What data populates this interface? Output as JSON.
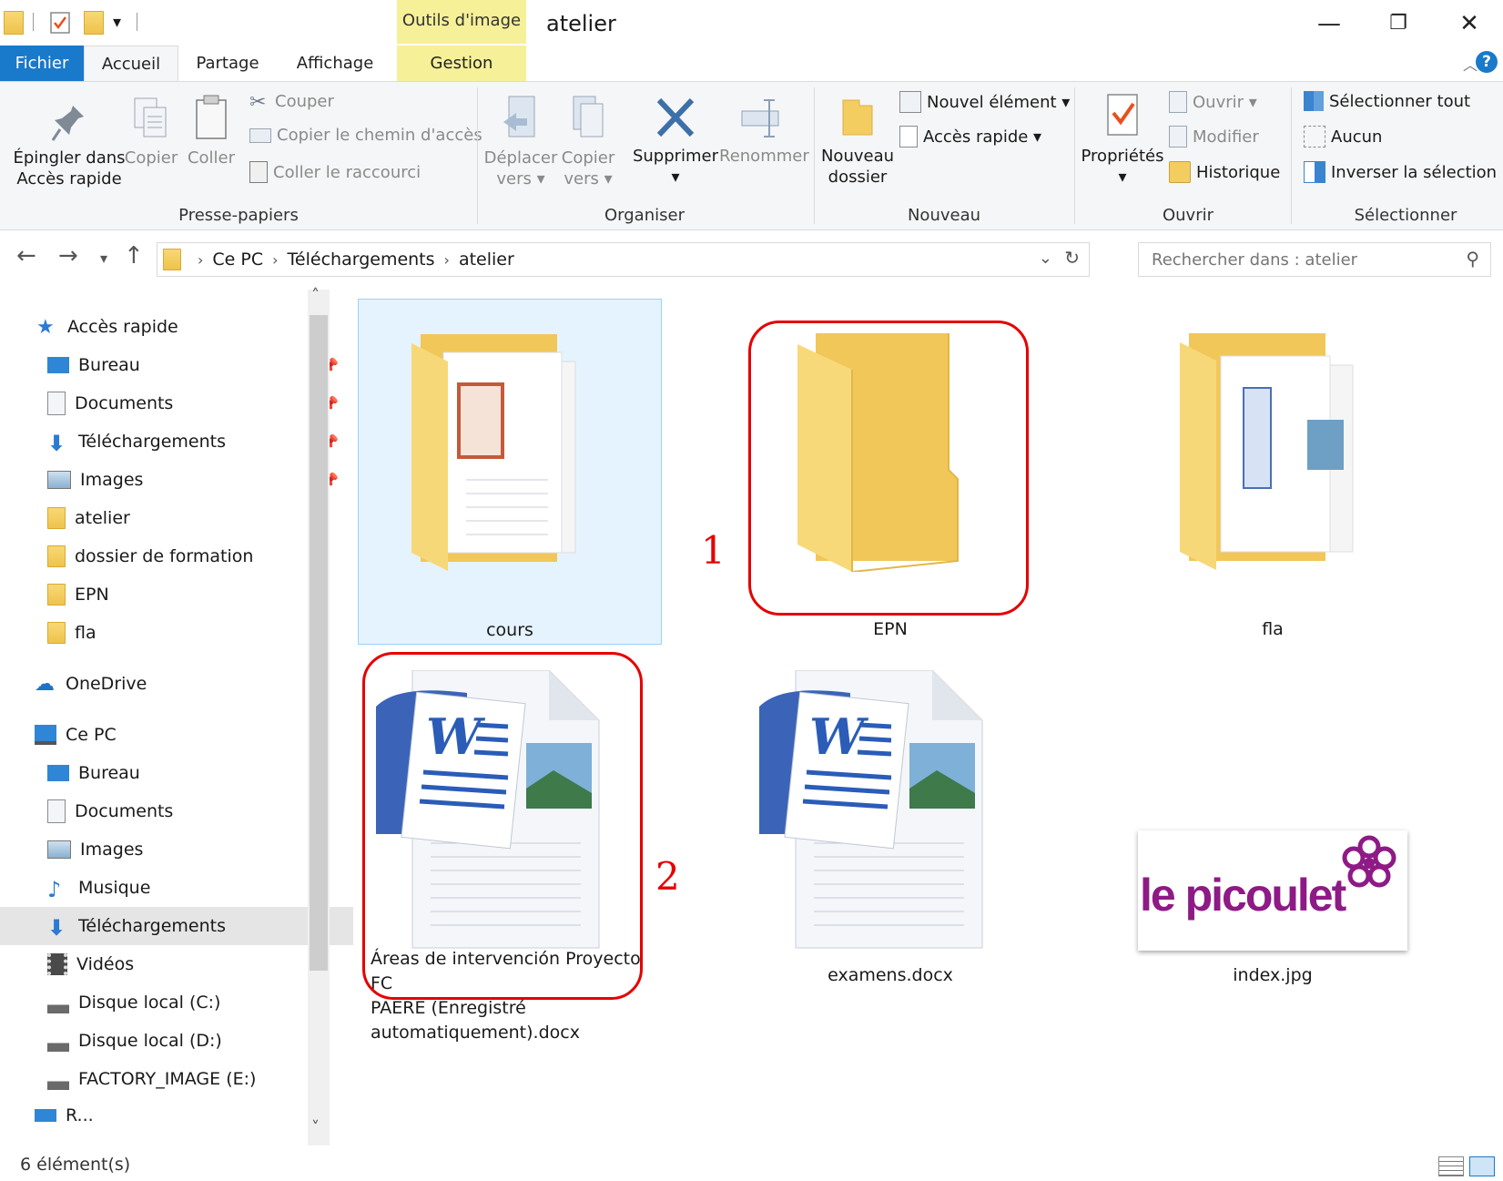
{
  "window": {
    "title": "atelier",
    "tools_tab": "Outils d'image",
    "minimize_glyph": "—",
    "restore_glyph": "❐",
    "close_glyph": "✕"
  },
  "tabs": {
    "file": "Fichier",
    "home": "Accueil",
    "share": "Partage",
    "view": "Affichage",
    "manage": "Gestion"
  },
  "ribbon": {
    "pin_line1": "Épingler dans",
    "pin_line2": "Accès rapide",
    "copy": "Copier",
    "paste": "Coller",
    "cut": "Couper",
    "copy_path": "Copier le chemin d'accès",
    "paste_shortcut": "Coller le raccourci",
    "group_clipboard": "Presse-papiers",
    "move_line1": "Déplacer",
    "move_line2": "vers ▾",
    "copyto_line1": "Copier",
    "copyto_line2": "vers ▾",
    "delete": "Supprimer",
    "rename": "Renommer",
    "group_organize": "Organiser",
    "new_folder_line1": "Nouveau",
    "new_folder_line2": "dossier",
    "new_item": "Nouvel élément ▾",
    "quick_access": "Accès rapide ▾",
    "group_new": "Nouveau",
    "properties": "Propriétés",
    "open": "Ouvrir ▾",
    "edit": "Modifier",
    "history": "Historique",
    "group_open": "Ouvrir",
    "select_all": "Sélectionner tout",
    "select_none": "Aucun",
    "invert_selection": "Inverser la sélection",
    "group_select": "Sélectionner"
  },
  "address": {
    "crumbs": [
      "Ce PC",
      "Téléchargements",
      "atelier"
    ],
    "search_placeholder": "Rechercher dans : atelier"
  },
  "sidebar": {
    "quick_access": "Accès rapide",
    "quick_items": [
      "Bureau",
      "Documents",
      "Téléchargements",
      "Images",
      "atelier",
      "dossier de formation",
      "EPN",
      "fla"
    ],
    "onedrive": "OneDrive",
    "this_pc": "Ce PC",
    "pc_items": [
      "Bureau",
      "Documents",
      "Images",
      "Musique",
      "Téléchargements",
      "Vidéos",
      "Disque local (C:)",
      "Disque local (D:)",
      "FACTORY_IMAGE (E:)"
    ],
    "partial_item": "R..."
  },
  "files": [
    {
      "name": "cours"
    },
    {
      "name": "EPN"
    },
    {
      "name": "fla"
    },
    {
      "name_line1": "Áreas de intervención Proyecto FC",
      "name_line2": "PAERE (Enregistré",
      "name_line3": "automatiquement).docx"
    },
    {
      "name": "examens.docx"
    },
    {
      "name": "index.jpg",
      "image_text": "le picoulet"
    }
  ],
  "annotations": [
    "1",
    "2"
  ],
  "status": {
    "count": "6 élément(s)"
  },
  "colors": {
    "accent": "#1979ca",
    "annotation": "#e60000",
    "folder": "#f4cd60",
    "picoulet": "#8e1a86"
  }
}
